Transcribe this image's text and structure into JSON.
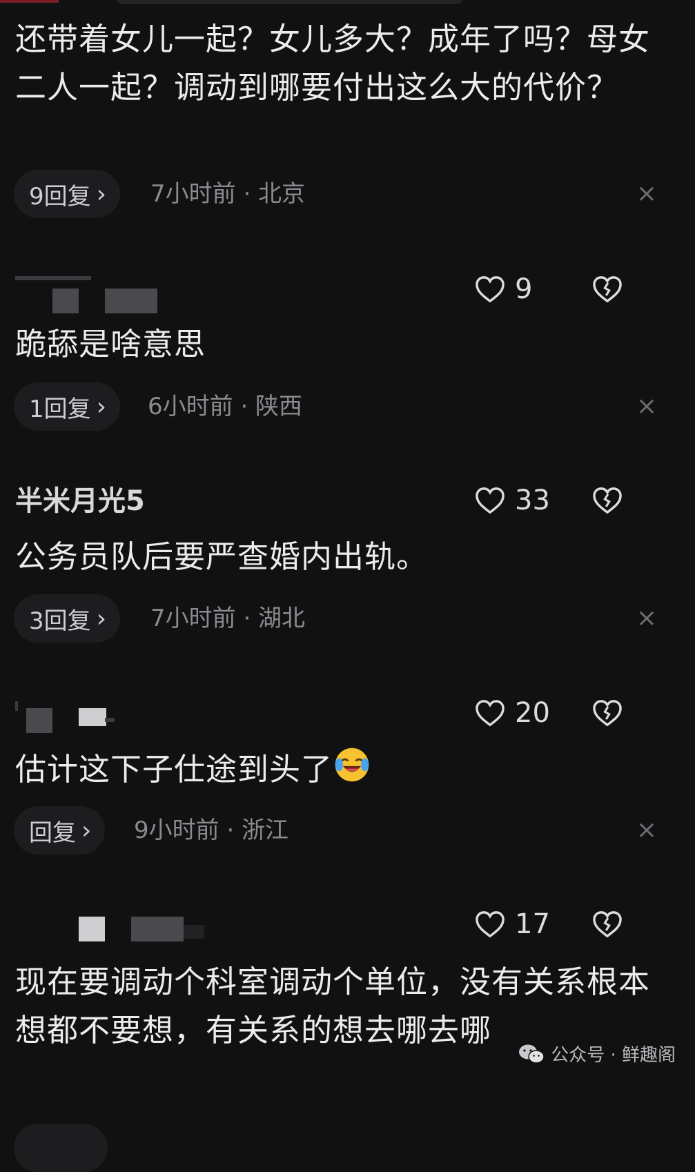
{
  "comments": [
    {
      "text": "还带着女儿一起？女儿多大？成年了吗？母女二人一起？调动到哪要付出这么大的代价？",
      "reply_label": "9回复",
      "time_location": "7小时前 · 北京"
    },
    {
      "likes": "9",
      "text": "跪舔是啥意思",
      "reply_label": "1回复",
      "time_location": "6小时前 · 陕西"
    },
    {
      "username": "半米月光5",
      "likes": "33",
      "text": "公务员队后要严查婚内出轨。",
      "reply_label": "3回复",
      "time_location": "7小时前 · 湖北"
    },
    {
      "likes": "20",
      "text": "估计这下子仕途到头了",
      "reply_label": "回复",
      "time_location": "9小时前 · 浙江"
    },
    {
      "likes": "17",
      "text": "现在要调动个科室调动个单位，没有关系根本想都不要想，有关系的想去哪去哪"
    }
  ],
  "common": {
    "chevron": "›",
    "close": "×"
  },
  "watermark": {
    "label": "公众号 · 鲜趣阁"
  },
  "icons": {
    "like": "heart-outline-icon",
    "dislike": "broken-heart-icon",
    "close": "close-icon",
    "emoji": "laughing-crying-emoji-icon",
    "wechat": "wechat-logo-icon"
  }
}
